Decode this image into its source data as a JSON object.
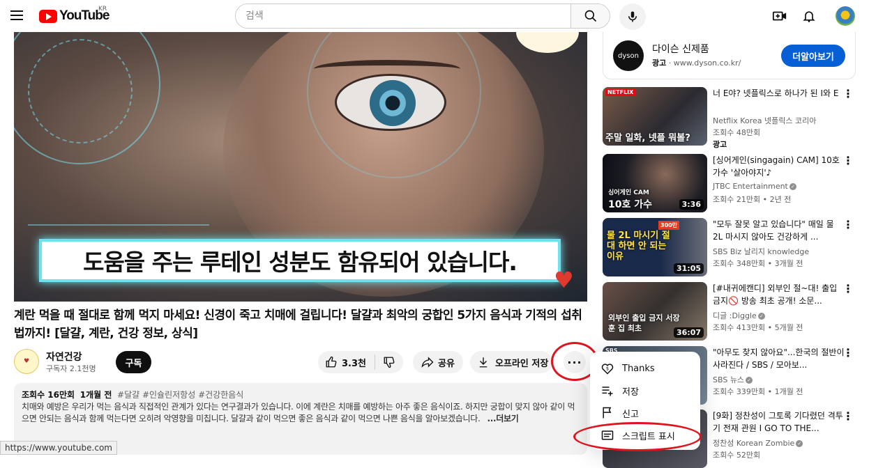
{
  "header": {
    "logo_text": "YouTube",
    "region": "KR",
    "search_placeholder": "검색"
  },
  "video": {
    "caption": "도움을 주는 루테인 성분도 함유되어 있습니다.",
    "title": "계란 먹을 때 절대로 함께 먹지 마세요! 신경이 죽고 치매에 걸립니다! 달걀과 최악의 궁합인 5가지 음식과 기적의 섭취법까지! [달걀, 계란, 건강 정보, 상식]"
  },
  "channel": {
    "name": "자연건강",
    "subscribers": "구독자 2.1천명",
    "subscribe_label": "구독"
  },
  "actions": {
    "likes": "3.3천",
    "share": "공유",
    "offline": "오프라인 저장",
    "more": "···"
  },
  "description": {
    "views": "조회수 16만회",
    "date": "1개월 전",
    "tags": "#달걀 #인슐린저항성 #건강한음식",
    "text": "치매와 예방은 우리가 먹는 음식과 직접적인 관계가 있다는 연구결과가 있습니다. 이에 계란은 치매를 예방하는 아주 좋은 음식이죠. 하지만 궁합이 맞지 않아 같이 먹으면 안되는 음식과 함께 먹는다면 오히려 악영향을 미칩니다. 달걀과 같이 먹으면 좋은 음식과 같이 먹으면 나쁜 음식을 알아보겠습니다.",
    "more": "...더보기"
  },
  "status_url": "https://www.youtube.com",
  "menu": {
    "items": [
      {
        "label": "Thanks",
        "icon": "thanks-icon"
      },
      {
        "label": "저장",
        "icon": "playlist-add-icon"
      },
      {
        "label": "신고",
        "icon": "flag-icon"
      },
      {
        "label": "스크립트 표시",
        "icon": "transcript-icon"
      }
    ]
  },
  "ad": {
    "logo": "dyson",
    "title": "다이슨 신제품",
    "label": "광고",
    "url": "www.dyson.co.kr/",
    "cta": "더알아보기"
  },
  "recommendations": [
    {
      "title": "너 E야? 넷플릭스로 하나가 된 I와 E",
      "channel": "Netflix Korea 넷플릭스 코리아",
      "meta": "조회수 48만회",
      "ad_tag": "광고",
      "duration": "",
      "thumb_text": "주말 일화, 넷플 뭐볼?",
      "thumb_badge": "NETFLIX"
    },
    {
      "title": "[싱어게인(singagain) CAM] 10호 가수 '살아야지'♪",
      "channel": "JTBC Entertainment",
      "meta": "조회수 21만회 • 2년 전",
      "duration": "3:36",
      "thumb_text": "10호 가수",
      "thumb_badge": "싱어게인 CAM"
    },
    {
      "title": "\"모두 잘못 알고 있습니다\" 매일 물 2L 마시지 않아도 건강하게 ...",
      "channel": "SBS Biz 날리지 knowledge",
      "meta": "조회수 348만회 • 3개월 전",
      "duration": "31:05",
      "thumb_text": "물 2L 마시기 절대 하면 안 되는 이유",
      "thumb_badge": "300만"
    },
    {
      "title": "[#내귀에캔디] 외부인 절~대! 출입 금지🚫 방송 최초 공개! 소문...",
      "channel": "디글 :Diggle",
      "meta": "조회수 413만회 • 5개월 전",
      "duration": "36:07",
      "thumb_text": "외부인 출입 금지 서장훈 집 최초",
      "thumb_badge": ""
    },
    {
      "title": "\"아무도 찾지 않아요\"...한국의 절반이 사라진다 / SBS / 모아보...",
      "channel": "SBS 뉴스",
      "meta": "조회수 339만회 • 1개월 전",
      "duration": "",
      "thumb_text": "",
      "thumb_badge": "SBS"
    },
    {
      "title": "[9화] 정찬성이 그토록 기다렸던 격투기 전재 관원 I GO TO THE...",
      "channel": "정찬성 Korean Zombie",
      "meta": "조회수 52만회",
      "duration": "",
      "thumb_text": "",
      "thumb_badge": ""
    }
  ]
}
